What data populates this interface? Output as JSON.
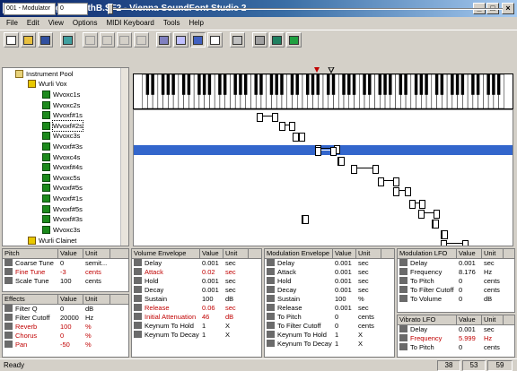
{
  "window": {
    "title": "DPOAudigy2SynthB.SF2 - Vienna SoundFont Studio 2"
  },
  "menu": [
    "File",
    "Edit",
    "View",
    "Options",
    "MIDI Keyboard",
    "Tools",
    "Help"
  ],
  "controls": {
    "modulator_select": "001 - Modulator",
    "modulator_value": "0"
  },
  "tree": {
    "root": "Instrument Pool",
    "preset": "Wurli Vox",
    "items": [
      "Wvoxc1s",
      "Wvoxc2s",
      "Wvoxf#1s",
      "Wvoxf#2s",
      "Wvoxc3s",
      "Wvoxf#3s",
      "Wvoxc4s",
      "Wvoxf#4s",
      "Wvoxc5s",
      "Wvoxf#5s",
      "Wvoxf#1s",
      "Wvoxf#5s",
      "Wvoxf#3s",
      "Wvoxc3s"
    ],
    "selected_index": 3,
    "next_preset": "Wurli Clainet"
  },
  "pitch": {
    "cols": [
      "Pitch",
      "Value",
      "Unit"
    ],
    "rows": [
      {
        "label": "Coarse Tune",
        "value": "0",
        "unit": "semit...",
        "red": false
      },
      {
        "label": "Fine Tune",
        "value": "-3",
        "unit": "cents",
        "red": true
      },
      {
        "label": "Scale Tune",
        "value": "100",
        "unit": "cents",
        "red": false
      }
    ]
  },
  "effects": {
    "cols": [
      "Effects",
      "Value",
      "Unit"
    ],
    "rows": [
      {
        "label": "Filter Q",
        "value": "0",
        "unit": "dB",
        "red": false
      },
      {
        "label": "Filter Cutoff",
        "value": "20000",
        "unit": "Hz",
        "red": false
      },
      {
        "label": "Reverb",
        "value": "100",
        "unit": "%",
        "red": true
      },
      {
        "label": "Chorus",
        "value": "0",
        "unit": "%",
        "red": true
      },
      {
        "label": "Pan",
        "value": "-50",
        "unit": "%",
        "red": true
      }
    ]
  },
  "vol_env": {
    "cols": [
      "Volume Envelope",
      "Value",
      "Unit"
    ],
    "rows": [
      {
        "label": "Delay",
        "value": "0.001",
        "unit": "sec",
        "red": false
      },
      {
        "label": "Attack",
        "value": "0.02",
        "unit": "sec",
        "red": true
      },
      {
        "label": "Hold",
        "value": "0.001",
        "unit": "sec",
        "red": false
      },
      {
        "label": "Decay",
        "value": "0.001",
        "unit": "sec",
        "red": false
      },
      {
        "label": "Sustain",
        "value": "100",
        "unit": "dB",
        "red": false
      },
      {
        "label": "Release",
        "value": "0.06",
        "unit": "sec",
        "red": true
      },
      {
        "label": "Initial Attenuation",
        "value": "46",
        "unit": "dB",
        "red": true
      },
      {
        "label": "Keynum To Hold",
        "value": "1",
        "unit": "X",
        "red": false
      },
      {
        "label": "Keynum To Decay",
        "value": "1",
        "unit": "X",
        "red": false
      }
    ]
  },
  "mod_env": {
    "cols": [
      "Modulation Envelope",
      "Value",
      "Unit"
    ],
    "rows": [
      {
        "label": "Delay",
        "value": "0.001",
        "unit": "sec",
        "red": false
      },
      {
        "label": "Attack",
        "value": "0.001",
        "unit": "sec",
        "red": false
      },
      {
        "label": "Hold",
        "value": "0.001",
        "unit": "sec",
        "red": false
      },
      {
        "label": "Decay",
        "value": "0.001",
        "unit": "sec",
        "red": false
      },
      {
        "label": "Sustain",
        "value": "100",
        "unit": "%",
        "red": false
      },
      {
        "label": "Release",
        "value": "0.001",
        "unit": "sec",
        "red": false
      },
      {
        "label": "To Pitch",
        "value": "0",
        "unit": "cents",
        "red": false
      },
      {
        "label": "To Filter Cutoff",
        "value": "0",
        "unit": "cents",
        "red": false
      },
      {
        "label": "Keynum To Hold",
        "value": "1",
        "unit": "X",
        "red": false
      },
      {
        "label": "Keynum To Decay",
        "value": "1",
        "unit": "X",
        "red": false
      }
    ]
  },
  "mod_lfo": {
    "cols": [
      "Modulation LFO",
      "Value",
      "Unit"
    ],
    "rows": [
      {
        "label": "Delay",
        "value": "0.001",
        "unit": "sec",
        "red": false
      },
      {
        "label": "Frequency",
        "value": "8.176",
        "unit": "Hz",
        "red": false
      },
      {
        "label": "To Pitch",
        "value": "0",
        "unit": "cents",
        "red": false
      },
      {
        "label": "To Filter Cutoff",
        "value": "0",
        "unit": "cents",
        "red": false
      },
      {
        "label": "To Volume",
        "value": "0",
        "unit": "dB",
        "red": false
      }
    ]
  },
  "vib_lfo": {
    "cols": [
      "Vibrato LFO",
      "Value",
      "Unit"
    ],
    "rows": [
      {
        "label": "Delay",
        "value": "0.001",
        "unit": "sec",
        "red": false
      },
      {
        "label": "Frequency",
        "value": "5.999",
        "unit": "Hz",
        "red": true
      },
      {
        "label": "To Pitch",
        "value": "0",
        "unit": "cents",
        "red": false
      }
    ]
  },
  "status": {
    "text": "Ready",
    "f1": "38",
    "f2": "53",
    "f3": "59"
  }
}
